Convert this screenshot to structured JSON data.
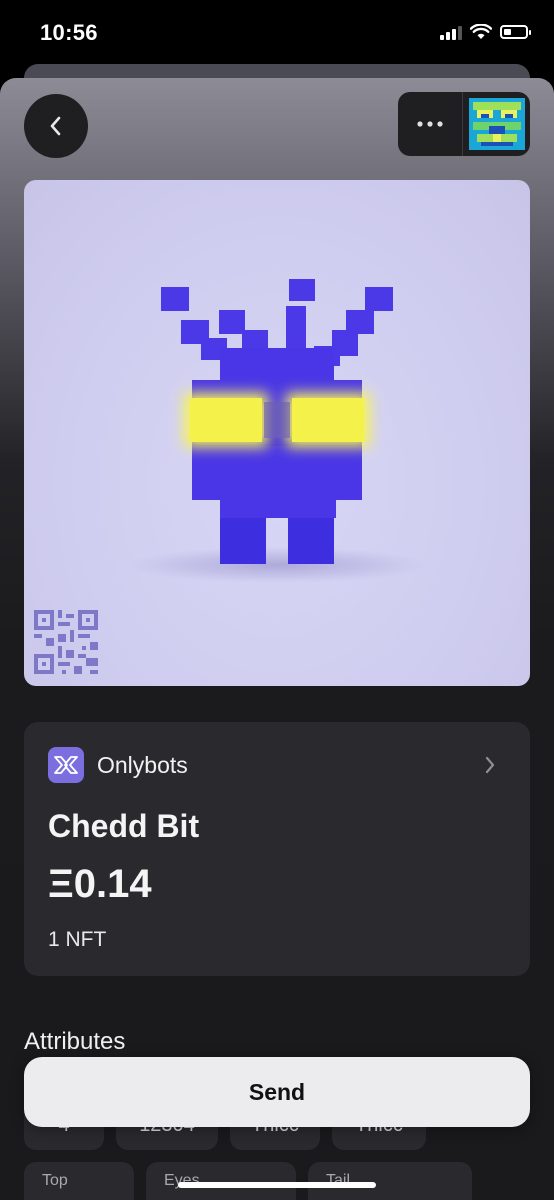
{
  "status_bar": {
    "time": "10:56",
    "icons": [
      "cellular-signal-icon",
      "wifi-icon",
      "battery-icon"
    ],
    "battery_level_fraction": 0.35
  },
  "header": {
    "back_icon": "chevron-left-icon",
    "more_icon": "ellipsis-icon",
    "avatar_icon": "pixel-robot-avatar-icon"
  },
  "nft": {
    "image_icon": "pixel-robot-nft-image",
    "qr_icon": "qr-code-icon",
    "collection": "Onlybots",
    "collection_icon": "onlybots-logo-icon",
    "chevron_icon": "chevron-right-icon",
    "name": "Chedd Bit",
    "price": "Ξ0.14",
    "count": "1 NFT"
  },
  "attributes": {
    "title": "Attributes",
    "values_row": [
      "4",
      "12304",
      "Thicc",
      "Thicc"
    ],
    "labels_row": [
      "Top",
      "Eyes",
      "Tail"
    ]
  },
  "actions": {
    "send_label": "Send"
  },
  "colors": {
    "robot_body": "#4a36e6",
    "robot_eyes": "#f4f24a",
    "image_background": "#cfcdef",
    "card_background": "#2a2a2e",
    "send_button": "#ececee"
  }
}
